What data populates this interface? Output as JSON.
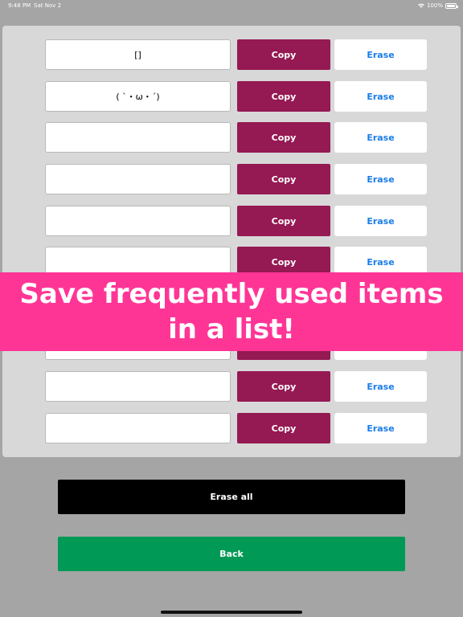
{
  "status": {
    "time": "9:48 PM",
    "date": "Sat Nov 2",
    "battery": "100%"
  },
  "rows": [
    {
      "value": "[]",
      "copy_label": "Copy",
      "erase_label": "Erase"
    },
    {
      "value": "( ˋ・ω・ˊ)",
      "copy_label": "Copy",
      "erase_label": "Erase"
    },
    {
      "value": "",
      "copy_label": "Copy",
      "erase_label": "Erase"
    },
    {
      "value": "",
      "copy_label": "Copy",
      "erase_label": "Erase"
    },
    {
      "value": "",
      "copy_label": "Copy",
      "erase_label": "Erase"
    },
    {
      "value": "",
      "copy_label": "Copy",
      "erase_label": "Erase"
    },
    {
      "value": "",
      "copy_label": "Copy",
      "erase_label": "Erase"
    },
    {
      "value": "",
      "copy_label": "Copy",
      "erase_label": "Erase"
    },
    {
      "value": "",
      "copy_label": "Copy",
      "erase_label": "Erase"
    }
  ],
  "banner": {
    "line1": "Save frequently used items",
    "line2": "in a list!"
  },
  "erase_all_label": "Erase all",
  "back_label": "Back",
  "colors": {
    "copy": "#951953",
    "erase_text": "#1a7de8",
    "banner": "#ff3596",
    "back": "#009955"
  }
}
